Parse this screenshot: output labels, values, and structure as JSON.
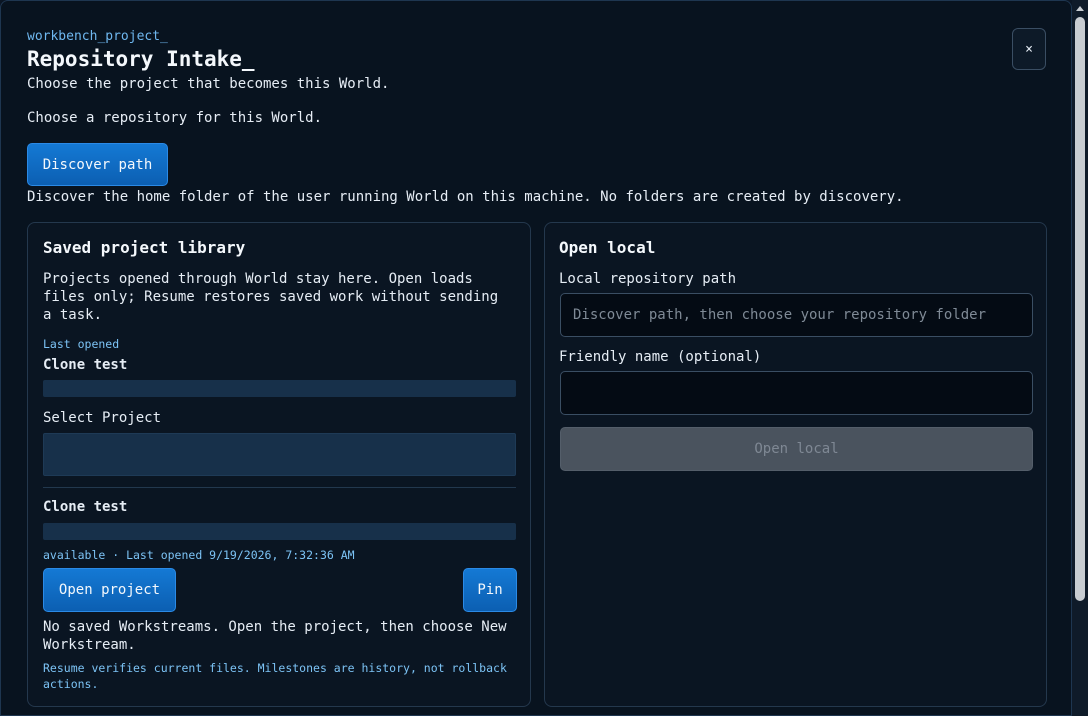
{
  "header": {
    "kicker": "workbench_project_",
    "title": "Repository Intake_",
    "subtitle": "Choose the project that becomes this World.",
    "close_label": "×"
  },
  "intake": {
    "prompt": "Choose a repository for this World.",
    "discover_label": "Discover path",
    "discover_hint": "Discover the home folder of the user running World on this machine. No folders are created by discovery."
  },
  "library": {
    "title": "Saved project library",
    "description": "Projects opened through World stay here. Open loads files only; Resume restores saved work without sending a task.",
    "last_opened_label": "Last opened",
    "last_opened_name": "Clone test",
    "select_label": "Select Project",
    "project": {
      "name": "Clone test",
      "meta": "available · Last opened 9/19/2026, 7:32:36 AM",
      "open_label": "Open project",
      "pin_label": "Pin"
    },
    "workstreams_note": "No saved Workstreams. Open the project, then choose New Workstream.",
    "resume_note": "Resume verifies current files. Milestones are history, not rollback actions."
  },
  "open_local": {
    "title": "Open local",
    "path_label": "Local repository path",
    "path_placeholder": "Discover path, then choose your repository folder",
    "path_value": "",
    "name_label": "Friendly name (optional)",
    "name_value": "",
    "submit_label": "Open local"
  },
  "colors": {
    "accent": "#1479d4",
    "background": "#08131f",
    "link": "#7cc3f5",
    "disabled": "#4a535e"
  }
}
